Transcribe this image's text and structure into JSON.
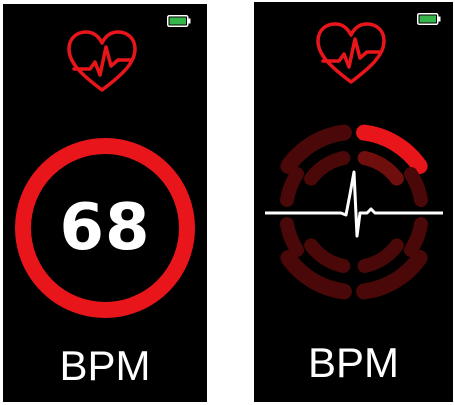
{
  "left_screen": {
    "heart_rate_value": "68",
    "unit_label": "BPM",
    "heart_icon": "heart-pulse-icon",
    "battery_icon": "battery-full-icon"
  },
  "right_screen": {
    "unit_label": "BPM",
    "heart_icon": "heart-pulse-icon",
    "battery_icon": "battery-full-icon"
  },
  "colors": {
    "accent_red": "#e8161b",
    "dim_red": "#4a0908",
    "mid_red": "#6e0f0d",
    "battery_green": "#35b54a",
    "background": "#000000",
    "text": "#ffffff"
  }
}
